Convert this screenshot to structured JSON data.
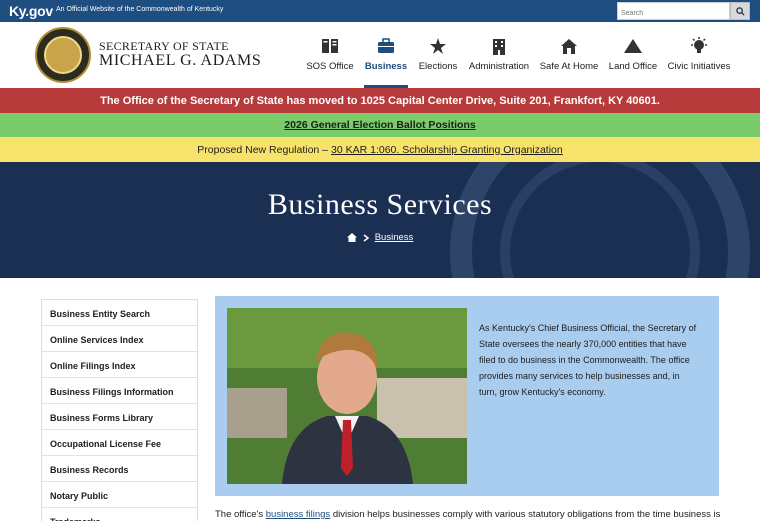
{
  "topbar": {
    "logo": "Ky.gov",
    "official_text": "An Official Website of the Commonwealth of Kentucky",
    "search_placeholder": "Search"
  },
  "header": {
    "line1": "SECRETARY OF STATE",
    "line2": "MICHAEL G. ADAMS"
  },
  "nav": [
    {
      "label": "SOS Office",
      "icon": "book-icon"
    },
    {
      "label": "Business",
      "icon": "briefcase-icon",
      "active": true
    },
    {
      "label": "Elections",
      "icon": "ballot-star-icon"
    },
    {
      "label": "Administration",
      "icon": "building-icon"
    },
    {
      "label": "Safe At Home",
      "icon": "house-icon"
    },
    {
      "label": "Land Office",
      "icon": "mountain-icon"
    },
    {
      "label": "Civic Initiatives",
      "icon": "lightbulb-icon"
    }
  ],
  "alerts": {
    "red": "The Office of the Secretary of State has moved to 1025 Capital Center Drive, Suite 201, Frankfort, KY 40601.",
    "green": "2026 General Election Ballot Positions",
    "yellow_prefix": "Proposed New Regulation –",
    "yellow_link": "30 KAR 1:060. Scholarship Granting Organization"
  },
  "hero": {
    "title": "Business Services",
    "breadcrumb": "Business"
  },
  "sidebar": [
    "Business Entity Search",
    "Online Services Index",
    "Online Filings Index",
    "Business Filings Information",
    "Business Forms Library",
    "Occupational License Fee",
    "Business Records",
    "Notary Public",
    "Trademarks"
  ],
  "main": {
    "intro": "As Kentucky's Chief Business Official, the Secretary of State oversees the nearly 370,000 entities that have filed to do business in the Commonwealth. The office provides many services to help businesses and, in turn, grow Kentucky's economy.",
    "body_prefix": "The office's",
    "body_link": "business filings",
    "body_suffix": "division helps businesses comply with various statutory obligations from the time business is"
  },
  "colors": {
    "brand_blue": "#1e4d80",
    "alert_red": "#b83b3b",
    "alert_green": "#7acc6a",
    "alert_yellow": "#f7e36b",
    "hero_navy": "#1a2f52",
    "content_blue": "#a9cdee"
  }
}
